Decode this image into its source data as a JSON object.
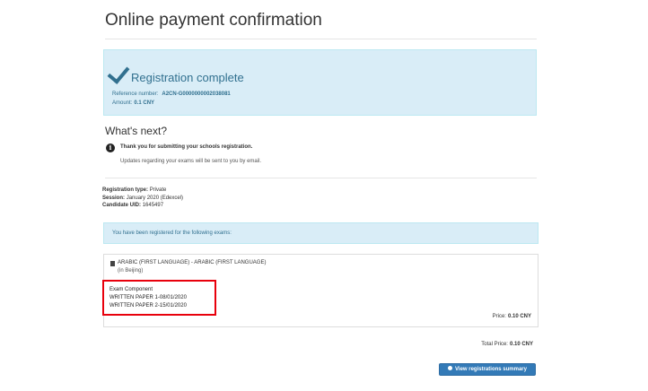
{
  "page": {
    "title": "Online payment confirmation"
  },
  "success": {
    "title": "Registration complete",
    "reference_label": "Reference number:",
    "reference_value": "A2CN-G0000000002038081",
    "amount_label": "Amount:",
    "amount_value": "0.1 CNY"
  },
  "next": {
    "heading": "What's next?",
    "thanks": "Thank you for submitting your schools registration.",
    "updates": "Updates regarding your exams will be sent to you by email."
  },
  "registration": {
    "type_label": "Registration type:",
    "type_value": "Private",
    "session_label": "Session:",
    "session_value": "January 2020 (Edexcel)",
    "uid_label": "Candidate UID:",
    "uid_value": "1645497"
  },
  "registered_notice": "You have been registered for the following exams:",
  "exam": {
    "name": "ARABIC (FIRST LANGUAGE) - ARABIC (FIRST LANGUAGE)",
    "location": "(in Beijing)",
    "component_heading": "Exam Component",
    "components": [
      "WRITTEN PAPER 1-08/01/2020",
      "WRITTEN PAPER 2-15/01/2020"
    ],
    "price_label": "Price:",
    "price_value": "0.10 CNY"
  },
  "total": {
    "label": "Total Price:",
    "value": "0.10 CNY"
  },
  "button": {
    "label": "View registrations summary",
    "icon": "eye-icon"
  },
  "colors": {
    "info_bg": "#d9edf7",
    "info_text": "#31708f",
    "highlight": "#e8000c",
    "primary": "#337ab7"
  }
}
